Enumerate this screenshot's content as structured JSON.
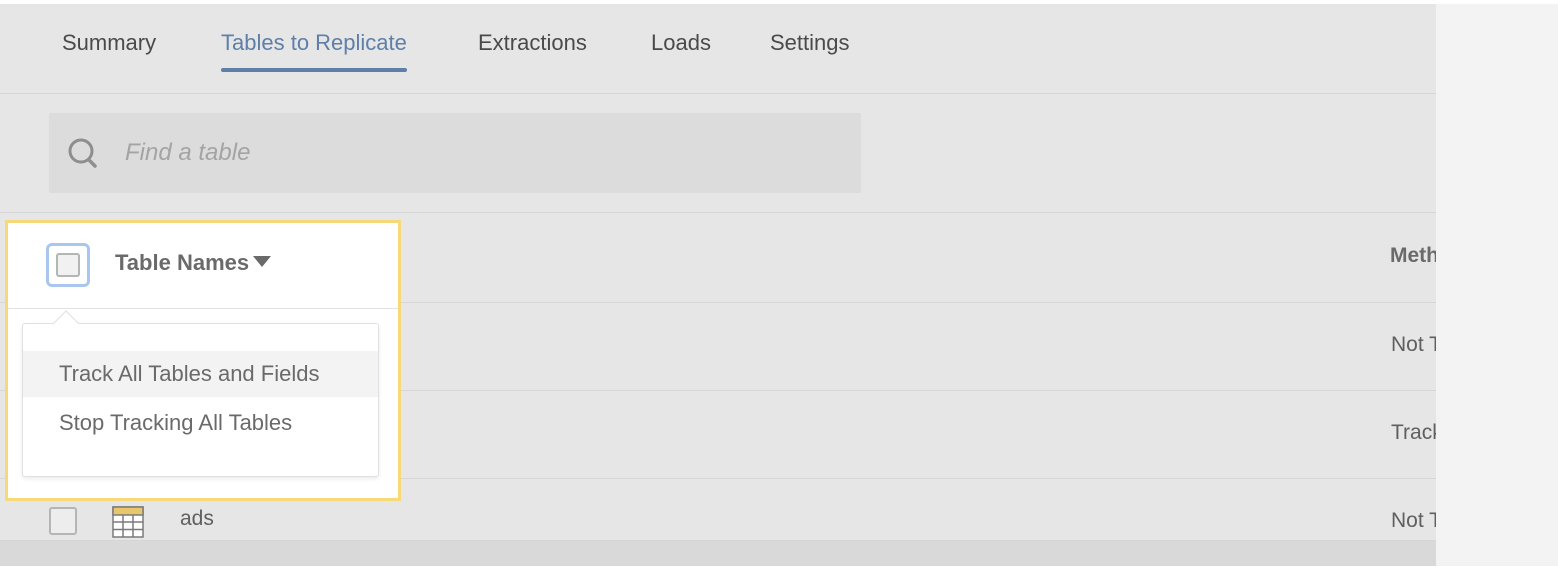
{
  "tabs": [
    {
      "label": "Summary",
      "active": false
    },
    {
      "label": "Tables to Replicate",
      "active": true
    },
    {
      "label": "Extractions",
      "active": false
    },
    {
      "label": "Loads",
      "active": false
    },
    {
      "label": "Settings",
      "active": false
    }
  ],
  "search": {
    "placeholder": "Find a table",
    "icon": "search-icon"
  },
  "table": {
    "columns": {
      "name": "Table Names",
      "method": "Method"
    },
    "rows": [
      {
        "name": "",
        "method": "Not Tracked"
      },
      {
        "name": "",
        "method": "Tracked"
      },
      {
        "name": "ads",
        "method": "Not Tracked",
        "icon": "table-grid-icon"
      }
    ]
  },
  "bulk_menu": {
    "items": [
      {
        "label": "Track All Tables and Fields",
        "hovered": true
      },
      {
        "label": "Stop Tracking All Tables",
        "hovered": false
      }
    ]
  },
  "colors": {
    "accent": "#5e7fa8",
    "highlight_border": "#f7d97a",
    "checkbox_focus": "#a9c6ef",
    "background": "#e6e6e6"
  }
}
